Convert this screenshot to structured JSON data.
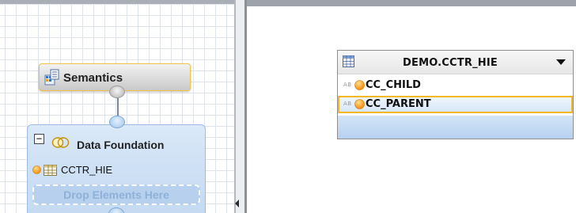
{
  "modeler": {
    "semantics_node": {
      "label": "Semantics"
    },
    "data_foundation_node": {
      "collapse_symbol": "−",
      "label": "Data Foundation",
      "tables": [
        {
          "label": "CCTR_HIE"
        }
      ],
      "drop_zone_label": "Drop Elements Here"
    }
  },
  "table_widget": {
    "title": "DEMO.CCTR_HIE",
    "columns": [
      {
        "type_badge": "AB",
        "label": "CC_CHILD",
        "selected": false
      },
      {
        "type_badge": "AB",
        "label": "CC_PARENT",
        "selected": true
      }
    ]
  },
  "colors": {
    "key_orange": "#f29a1f",
    "selection_border": "#f3b925",
    "node_blue": "#cfe1f5",
    "semantics_border": "#f0c24a"
  },
  "icons": [
    "semantics-icon",
    "join-icon",
    "table-icon",
    "key-icon",
    "dropdown-arrow-icon",
    "collapse-icon",
    "splitter-arrow-icon"
  ]
}
